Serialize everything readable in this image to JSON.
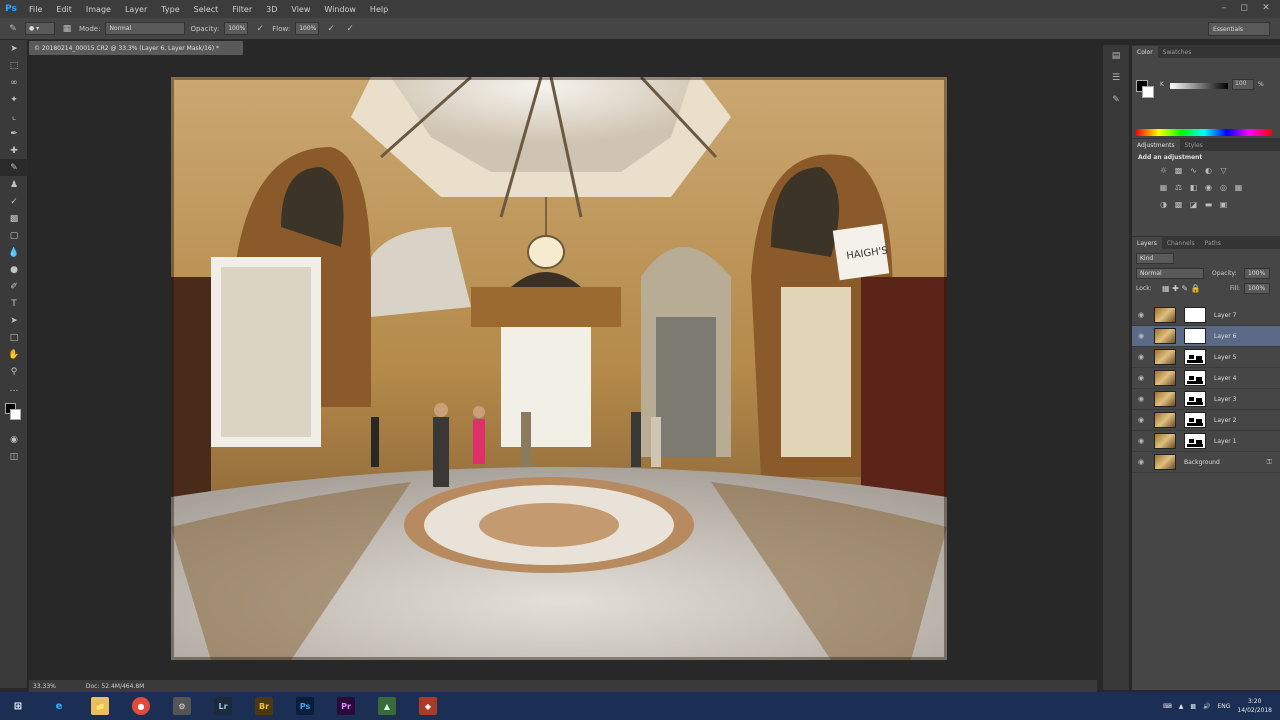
{
  "app": {
    "logo": "Ps",
    "menu": [
      "File",
      "Edit",
      "Image",
      "Layer",
      "Type",
      "Select",
      "Filter",
      "3D",
      "View",
      "Window",
      "Help"
    ],
    "window_controls": [
      "minimize-icon",
      "restore-icon",
      "close-icon"
    ]
  },
  "options_bar": {
    "mode_label": "Mode:",
    "mode_value": "Normal",
    "opacity_label": "Opacity:",
    "opacity_value": "100%",
    "flow_label": "Flow:",
    "flow_value": "100%",
    "workspace": "Essentials"
  },
  "document": {
    "tab_title": "© 20180214_00015.CR2 @ 33.3% (Layer 6, Layer Mask/16) *",
    "zoom": "33.33%",
    "doc_size": "Doc: 52.4M/464.8M"
  },
  "panels": {
    "color_tabs": [
      "Color",
      "Swatches"
    ],
    "k_label": "K",
    "k_value": "100",
    "k_unit": "%",
    "adjust_tabs": [
      "Adjustments",
      "Styles"
    ],
    "add_adjustment": "Add an adjustment",
    "layers_tabs": [
      "Layers",
      "Channels",
      "Paths"
    ],
    "kind_value": "Kind",
    "blend_mode": "Normal",
    "opacity_label": "Opacity:",
    "opacity_value": "100%",
    "lock_label": "Lock:",
    "fill_label": "Fill:",
    "fill_value": "100%"
  },
  "layers": [
    {
      "name": "Layer 7",
      "selected": false,
      "mask": "white"
    },
    {
      "name": "Layer 6",
      "selected": true,
      "mask": "white"
    },
    {
      "name": "Layer 5",
      "selected": false,
      "mask": "blots"
    },
    {
      "name": "Layer 4",
      "selected": false,
      "mask": "blots"
    },
    {
      "name": "Layer 3",
      "selected": false,
      "mask": "blots"
    },
    {
      "name": "Layer 2",
      "selected": false,
      "mask": "blots"
    },
    {
      "name": "Layer 1",
      "selected": false,
      "mask": "blots"
    },
    {
      "name": "Background",
      "selected": false,
      "mask": "none"
    }
  ],
  "taskbar": {
    "apps": [
      "windows-start-icon",
      "ie-icon",
      "explorer-icon",
      "chrome-icon",
      "app-icon",
      "Lr",
      "Br",
      "Ps",
      "Pr",
      "maps-icon",
      "app2-icon"
    ],
    "tray_lang": "ENG",
    "time": "3:20",
    "date": "14/02/2018"
  },
  "photo": {
    "sign_text": "HAIGH'S"
  }
}
